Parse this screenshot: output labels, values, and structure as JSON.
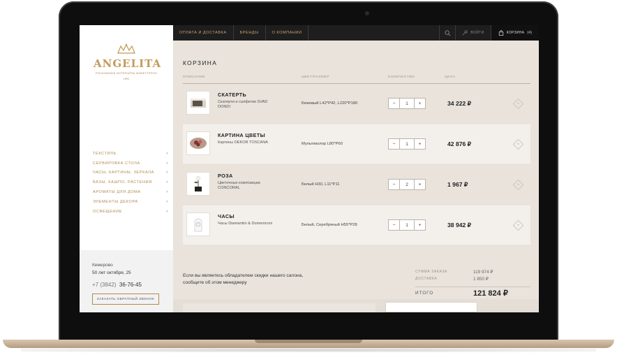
{
  "sidebar": {
    "logo": {
      "name": "ANGELITA",
      "tagline": "РОСКОШНЫЕ ИНТЕРЬЕРЫ ЖИЛЕТТЕРНО",
      "year": "1991"
    },
    "menu": [
      "ТЕКСТИЛЬ",
      "СЕРВИРОВКА СТОЛА",
      "ЧАСЫ, КАРТИНЫ, ЗЕРКАЛА",
      "ВАЗЫ, КАШПО, РАСТЕНИЯ",
      "АРОМАТЫ ДЛЯ ДОМА",
      "ЭЛЕМЕНТЫ ДЕКОРА",
      "ОСВЕЩЕНИЕ"
    ],
    "contact": {
      "city": "Кемерово",
      "address": "50 лет октября, 25",
      "phone_code": "+7 (3842)",
      "phone_number": "36-76-45",
      "callback_label": "ЗАКАЗАТЬ ОБРАТНЫЙ ЗВОНОК"
    }
  },
  "topnav": {
    "links": [
      "ОПЛАТА И ДОСТАВКА",
      "БРЕНДЫ",
      "О КОМПАНИИ"
    ],
    "login_label": "ВОЙТИ",
    "cart_label": "КОРЗИНА",
    "cart_count": "(4)"
  },
  "cart": {
    "title": "КОРЗИНА",
    "columns": {
      "description": "ОПИСАНИЕ",
      "color_size": "ЦВЕТ/РАЗМЕР",
      "quantity": "КОЛИЧЕСТВО",
      "price": "ЦЕНА"
    },
    "items": [
      {
        "name": "СКАТЕРТЬ",
        "subtitle": "Скатерти и салфетки SVAD DONDI",
        "color_size": "Бежевый L42*P42, L220*P180",
        "qty": "1",
        "price": "34 222 ₽"
      },
      {
        "name": "КАРТИНА ЦВЕТЫ",
        "subtitle": "Картины DEKOR TOSCANA",
        "color_size": "Мультиколор L80*P60",
        "qty": "1",
        "price": "42 876 ₽"
      },
      {
        "name": "РОЗА",
        "subtitle": "Цветочные композиции CONCORAL",
        "color_size": "Белый H30, L11*P11",
        "qty": "2",
        "price": "1 967 ₽"
      },
      {
        "name": "ЧАСЫ",
        "subtitle": "Часы Diamantini & Domeniconi",
        "color_size": "Белый, Серебряный H55*P28",
        "qty": "1",
        "price": "38 942 ₽"
      }
    ],
    "stepper": {
      "minus": "−",
      "plus": "+"
    },
    "summary": {
      "discount_note": "Если вы являетесь обладателем скидки нашего салона, сообщите об этом менеджеру",
      "order_sum_label": "СУММА ЗАКАЗА",
      "order_sum": "119 974 ₽",
      "delivery_label": "ДОСТАВКА",
      "delivery": "1 850 ₽",
      "total_label": "ИТОГО",
      "total": "121 824 ₽"
    }
  }
}
